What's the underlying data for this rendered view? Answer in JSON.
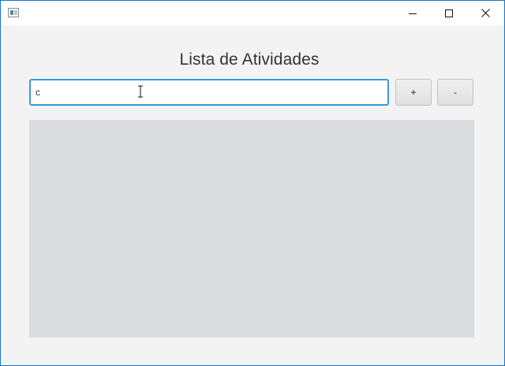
{
  "window": {
    "title": ""
  },
  "main": {
    "heading": "Lista de Atividades",
    "input": {
      "value": "c",
      "placeholder": ""
    },
    "add_button_label": "+",
    "remove_button_label": "-",
    "list_items": []
  },
  "colors": {
    "input_focus_border": "#3b9ad8",
    "list_background": "#dbdce0",
    "window_background": "#f3f3f3"
  },
  "icons": {
    "app": "app-window-icon",
    "minimize": "minimize-icon",
    "maximize": "maximize-icon",
    "close": "close-icon",
    "cursor": "text-cursor-icon"
  }
}
